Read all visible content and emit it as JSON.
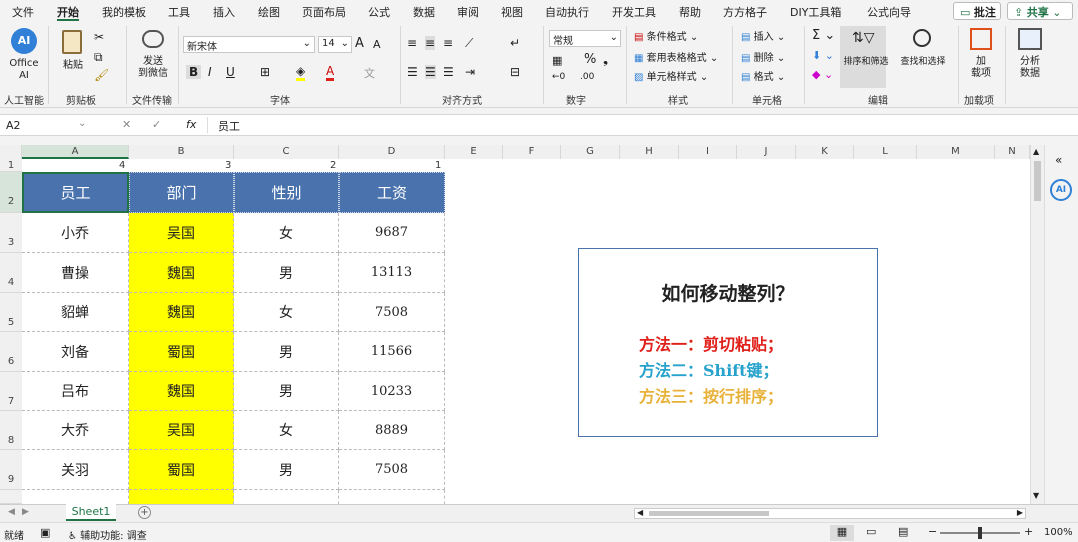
{
  "menu": {
    "items": [
      "文件",
      "开始",
      "我的模板",
      "工具",
      "插入",
      "绘图",
      "页面布局",
      "公式",
      "数据",
      "审阅",
      "视图",
      "自动执行",
      "开发工具",
      "帮助",
      "方方格子",
      "DIY工具箱",
      "公式向导"
    ],
    "comment_label": "批注",
    "share_label": "共享"
  },
  "ribbon": {
    "office_ai": "Office AI",
    "office_ai_line1": "Office",
    "office_ai_line2": "AI",
    "paste": "粘贴",
    "send": "发送",
    "to_wechat": "到微信",
    "font_name": "新宋体",
    "font_size": "14",
    "bold": "B",
    "italic": "I",
    "underline": "U",
    "number_format": "常规",
    "cond_format": "条件格式",
    "table_format": "套用表格格式",
    "cell_style": "单元格样式",
    "insert": "插入",
    "delete": "删除",
    "format": "格式",
    "sort_filter": "排序和筛选",
    "find_select": "查找和选择",
    "addins_line1": "加",
    "addins_line2": "载项",
    "analyze_line1": "分析",
    "analyze_line2": "数据",
    "groups": [
      "人工智能",
      "剪贴板",
      "文件传输",
      "字体",
      "对齐方式",
      "数字",
      "样式",
      "单元格",
      "编辑",
      "加载项"
    ]
  },
  "formula_bar": {
    "name_box": "A2",
    "fx": "fx",
    "content": "员工"
  },
  "grid": {
    "columns": [
      "A",
      "B",
      "C",
      "D",
      "E",
      "F",
      "G",
      "H",
      "I",
      "J",
      "K",
      "L",
      "M",
      "N"
    ],
    "rows": [
      "1",
      "2",
      "3",
      "4",
      "5",
      "6",
      "7",
      "8",
      "9"
    ],
    "row1_numbers": [
      "4",
      "3",
      "2",
      "1"
    ],
    "headers": [
      "员工",
      "部门",
      "性别",
      "工资"
    ],
    "data": [
      [
        "小乔",
        "吴国",
        "女",
        "9687"
      ],
      [
        "曹操",
        "魏国",
        "男",
        "13113"
      ],
      [
        "貂蝉",
        "魏国",
        "女",
        "7508"
      ],
      [
        "刘备",
        "蜀国",
        "男",
        "11566"
      ],
      [
        "吕布",
        "魏国",
        "男",
        "10233"
      ],
      [
        "大乔",
        "吴国",
        "女",
        "8889"
      ],
      [
        "关羽",
        "蜀国",
        "男",
        "7508"
      ]
    ]
  },
  "textbox": {
    "title": "如何移动整列？",
    "method1": "方法一：剪切粘贴；",
    "method2": "方法二：Shift键；",
    "method3": "方法三：按行排序；",
    "colors": {
      "method1": "#e0201a",
      "method2": "#26a2cc",
      "method3": "#e8b23a"
    }
  },
  "sheet_tab": "Sheet1",
  "status": {
    "ready": "就绪",
    "accessibility": "辅助功能: 调查",
    "zoom": "100%"
  },
  "colors": {
    "accent": "#217346",
    "header_fill": "#4a73ad",
    "highlight": "#ffff00"
  }
}
